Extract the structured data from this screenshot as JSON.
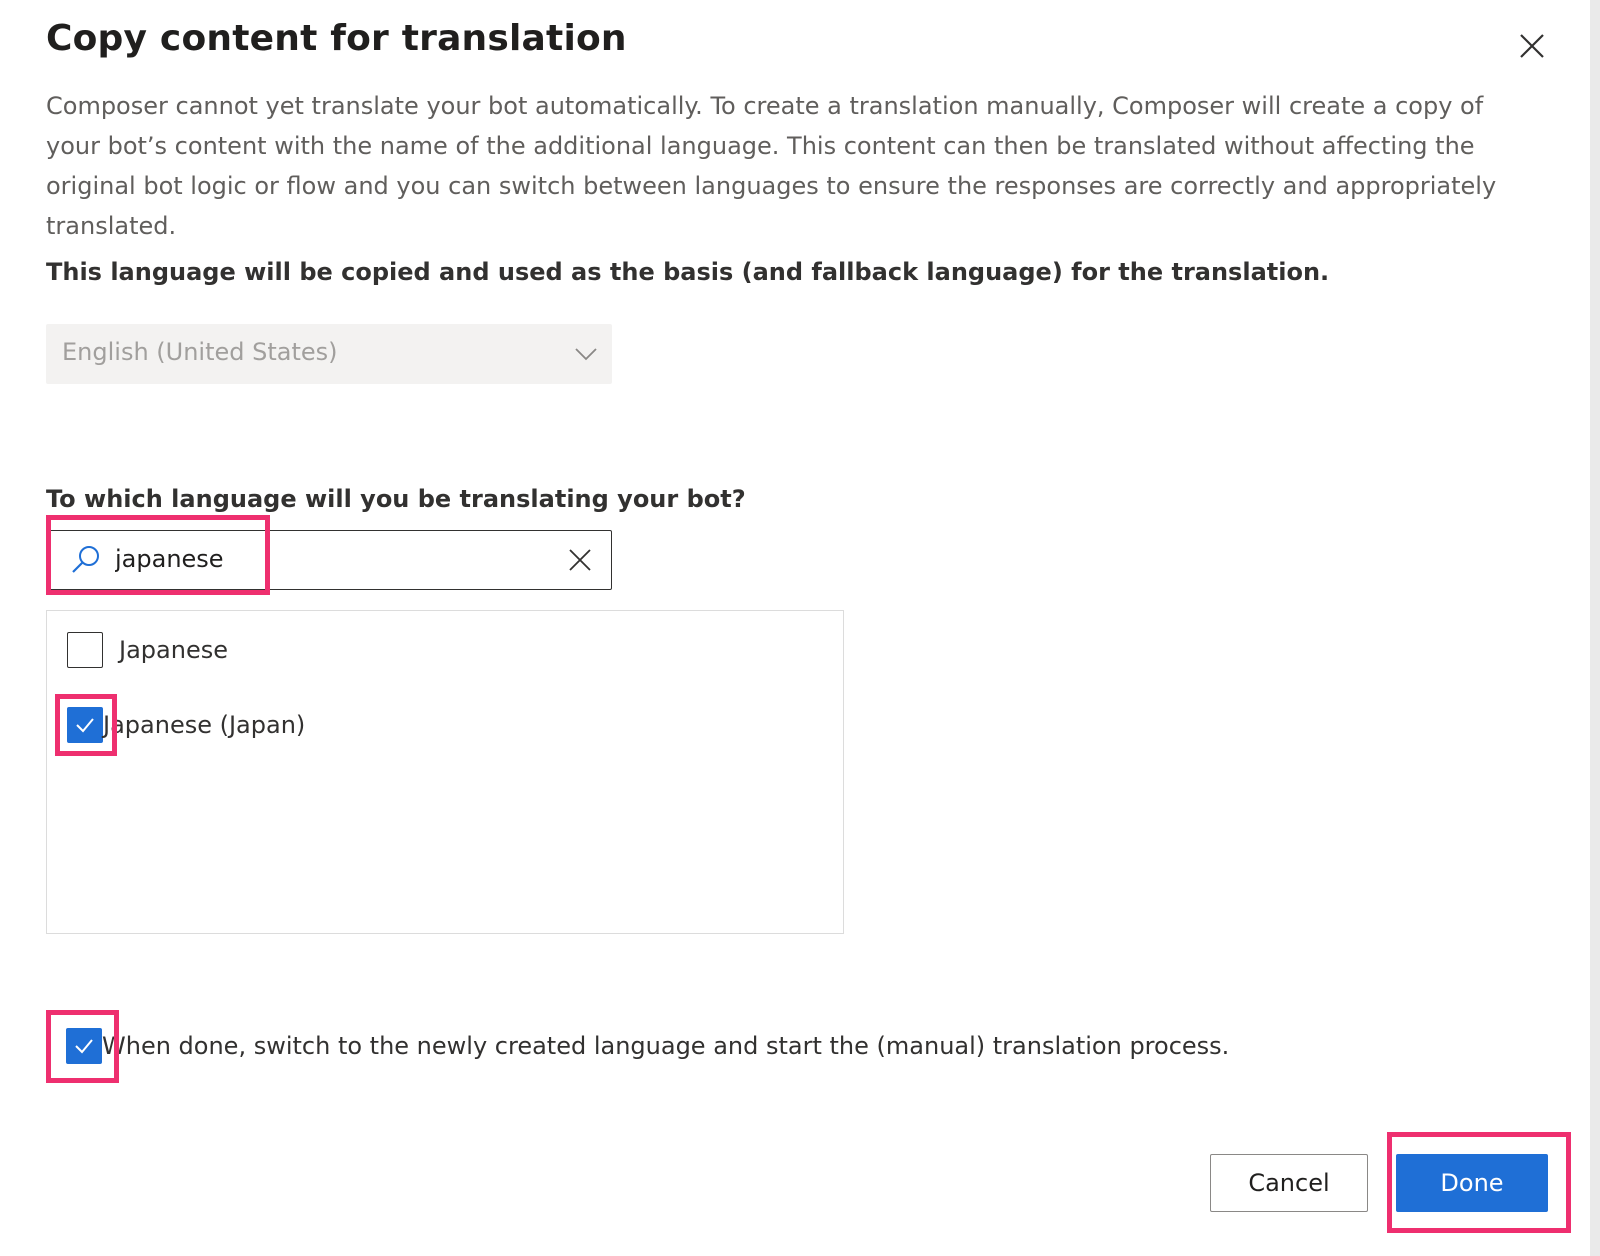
{
  "dialog": {
    "title": "Copy content for translation",
    "close_icon": "close-icon",
    "description": "Composer cannot yet translate your bot automatically. To create a translation manually, Composer will create a copy of your bot’s content with the name of the additional language. This content can then be translated without affecting the original bot logic or flow and you can switch between languages to ensure the responses are correctly and appropriately translated."
  },
  "base_language": {
    "label": "This language will be copied and used as the basis (and fallback language) for the translation.",
    "selected": "English (United States)",
    "disabled": true,
    "icon": "chevron-down-icon"
  },
  "target_language": {
    "label": "To which language will you be translating your bot?",
    "search_value": "japanese",
    "search_icon": "search-icon",
    "clear_icon": "close-icon",
    "options": [
      {
        "label": "Japanese",
        "checked": false
      },
      {
        "label": "Japanese (Japan)",
        "checked": true
      }
    ]
  },
  "switch_option": {
    "label": "When done, switch to the newly created language and start the (manual) translation process.",
    "checked": true
  },
  "footer": {
    "cancel_label": "Cancel",
    "done_label": "Done"
  },
  "colors": {
    "primary": "#1f6fd6",
    "highlight": "#ee2f6f"
  }
}
